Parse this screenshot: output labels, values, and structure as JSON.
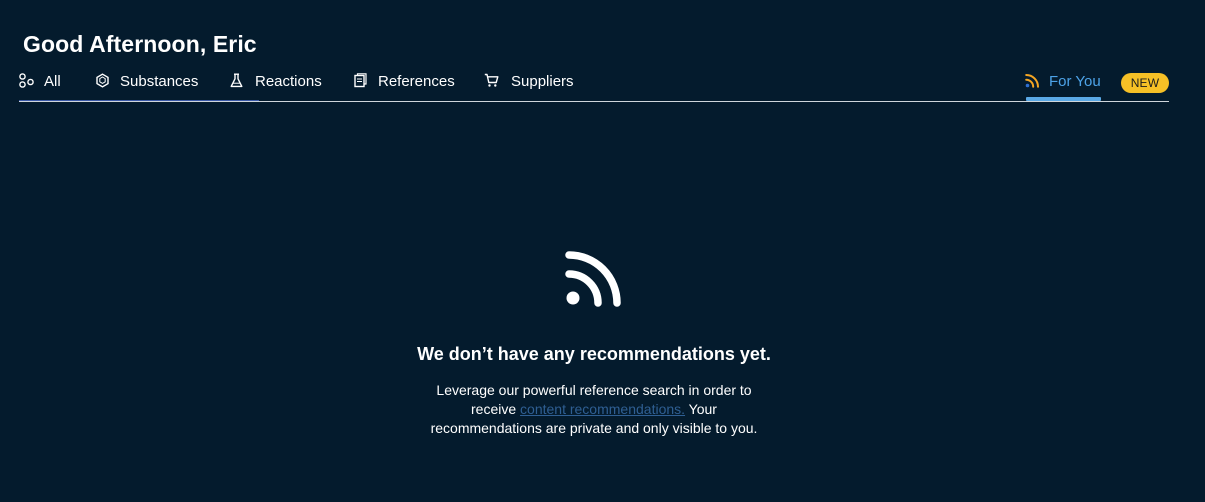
{
  "greeting": "Good Afternoon, Eric",
  "tabs": {
    "all": {
      "label": "All",
      "icon": "molecule-icon"
    },
    "substances": {
      "label": "Substances",
      "icon": "hexagon-icon"
    },
    "reactions": {
      "label": "Reactions",
      "icon": "flask-icon"
    },
    "references": {
      "label": "References",
      "icon": "document-icon"
    },
    "suppliers": {
      "label": "Suppliers",
      "icon": "cart-icon"
    },
    "foryou": {
      "label": "For You",
      "icon": "rss-icon",
      "active": true
    },
    "new_badge": "NEW"
  },
  "empty_state": {
    "icon": "rss-icon",
    "title": "We don’t have any recommendations yet.",
    "body_before": "Leverage our powerful reference search in order to receive ",
    "link_text": "content recommendations.",
    "body_after": " Your recommendations are private and only visible to you."
  },
  "colors": {
    "background": "#041b2d",
    "accent_blue": "#4da3e8",
    "badge_yellow": "#f6c026",
    "rss_orange": "#f5a623"
  }
}
